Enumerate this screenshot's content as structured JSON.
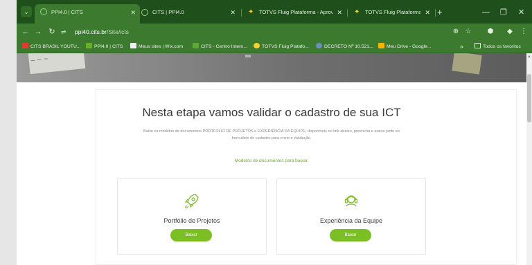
{
  "browser": {
    "tabs": [
      {
        "title": "PPI4.0 | CITS",
        "active": true,
        "favicon": "globe-icon"
      },
      {
        "title": "CITS | PPI4.0",
        "active": false,
        "favicon": "globe-icon"
      },
      {
        "title": "TOTVS Fluig Plataforma - Aprov",
        "active": false,
        "favicon": "fluig-icon"
      },
      {
        "title": "TOTVS Fluig Plataforma - Movi",
        "active": false,
        "favicon": "fluig-icon"
      }
    ],
    "new_tab": "+",
    "address": {
      "host": "ppi40.cits.br",
      "path": "/Site/icts"
    },
    "bookmarks": [
      {
        "label": "CITS BRASIL YOUTU...",
        "color": "#e03b2f"
      },
      {
        "label": "PPI4.0 | CITS",
        "color": "#6aae2c"
      },
      {
        "label": "Meus sites | Wix.com",
        "color": "#222222"
      },
      {
        "label": "CITS - Centro Intern...",
        "color": "#5fa93a"
      },
      {
        "label": "TOTVS Fluig Platafo...",
        "color": "#f5d22d"
      },
      {
        "label": "DECRETO Nº 10.521...",
        "color": "#6c8ebf"
      },
      {
        "label": "Meu Drive - Google...",
        "color": "#f4b400"
      }
    ],
    "bookmarks_more": "»",
    "all_bookmarks": "Todos os favoritos"
  },
  "page": {
    "headline": "Nesta etapa vamos validar o cadastro de sua ICT",
    "description_line1": "Baixe os modelos de documentos PORTFÓLIO DE PROJETOS e EXPERIÊNCIA DA EQUIPE, disponíveis no link abaixo, preencha e anexe junto ao",
    "description_line2": "formulário de cadastro para envio e validação.",
    "models_link": "Modelos de documentos para baixar.",
    "cards": [
      {
        "title": "Portfólio de Projetos",
        "button": "Baixar",
        "icon": "rocket-icon"
      },
      {
        "title": "Experiência da Equipe",
        "button": "Baixar",
        "icon": "headset-icon"
      }
    ]
  },
  "colors": {
    "accent_green": "#7cbf25",
    "browser_dark": "#1f4f1a",
    "browser_toolbar": "#3b7a2f"
  }
}
